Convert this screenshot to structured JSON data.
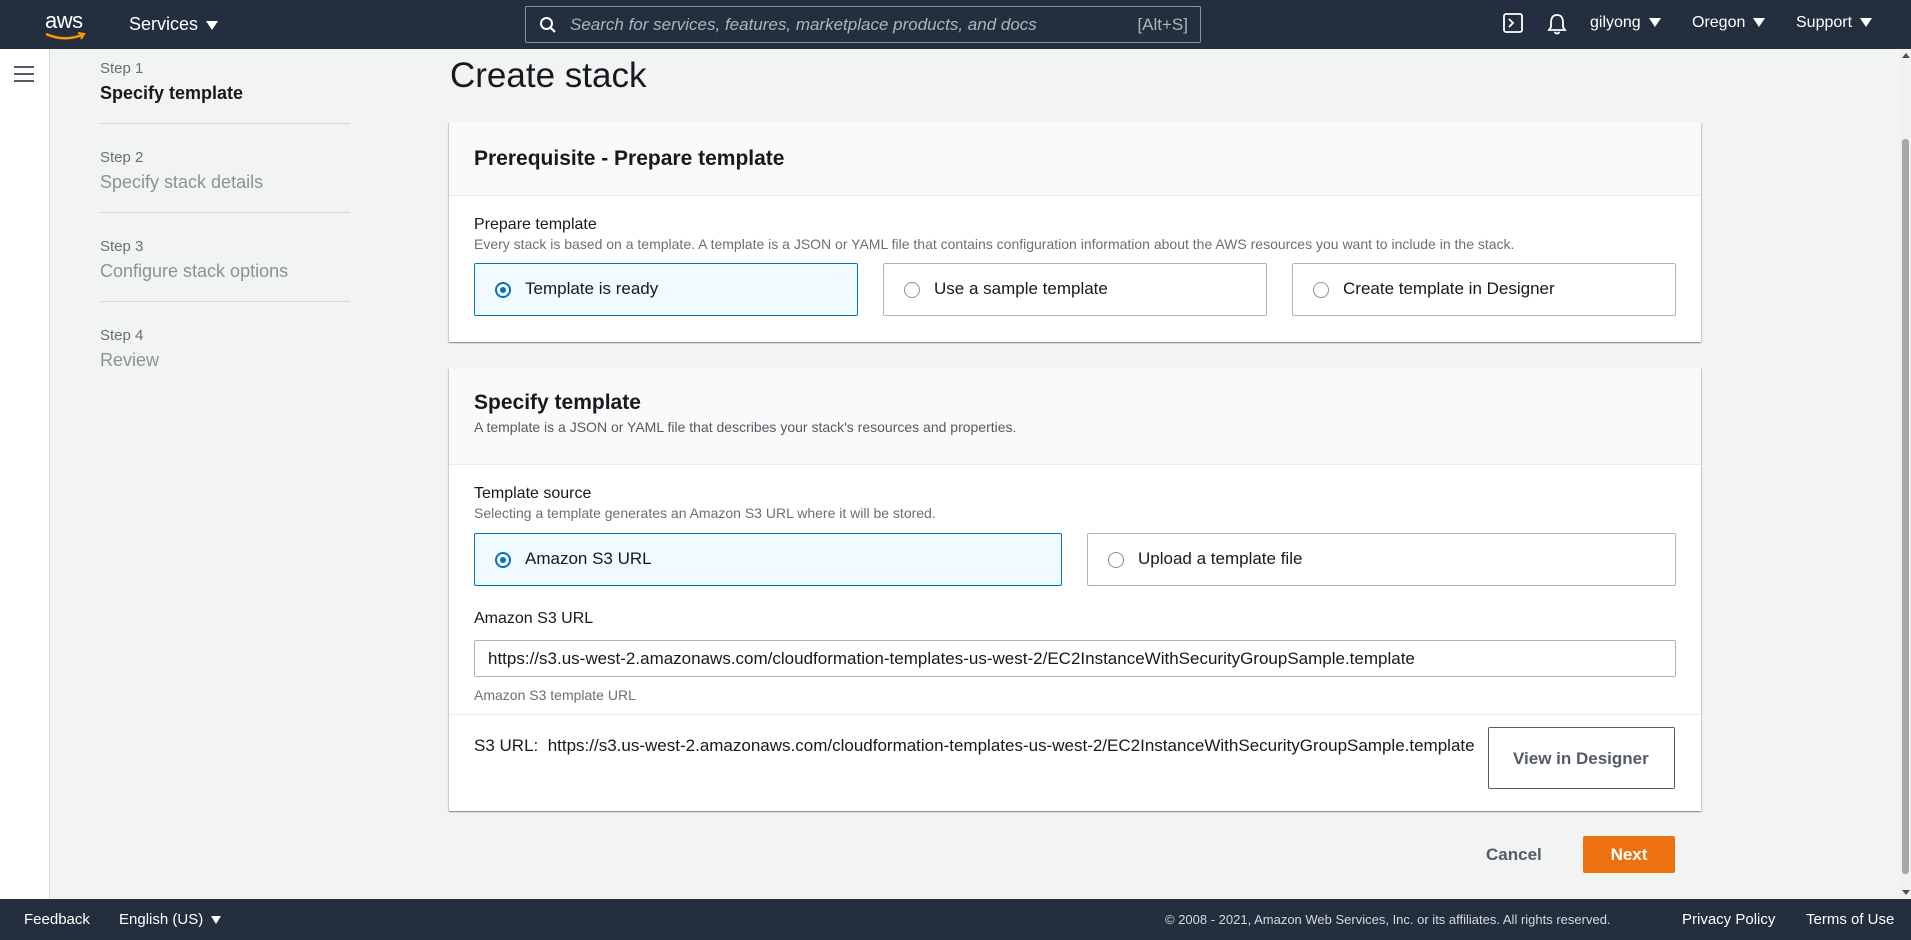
{
  "topnav": {
    "logo_text": "aws",
    "services_label": "Services",
    "search_placeholder": "Search for services, features, marketplace products, and docs",
    "search_shortcut": "[Alt+S]",
    "user_label": "gilyong",
    "region_label": "Oregon",
    "support_label": "Support",
    "icons": [
      "cloudshell-icon",
      "bell-icon"
    ]
  },
  "steps": [
    {
      "number": "Step 1",
      "title": "Specify template",
      "active": true
    },
    {
      "number": "Step 2",
      "title": "Specify stack details",
      "active": false
    },
    {
      "number": "Step 3",
      "title": "Configure stack options",
      "active": false
    },
    {
      "number": "Step 4",
      "title": "Review",
      "active": false
    }
  ],
  "page_title": "Create stack",
  "prerequisite": {
    "header": "Prerequisite - Prepare template",
    "field_label": "Prepare template",
    "field_desc": "Every stack is based on a template. A template is a JSON or YAML file that contains configuration information about the AWS resources you want to include in the stack.",
    "options": [
      {
        "label": "Template is ready",
        "selected": true
      },
      {
        "label": "Use a sample template",
        "selected": false
      },
      {
        "label": "Create template in Designer",
        "selected": false
      }
    ]
  },
  "specify": {
    "header": "Specify template",
    "header_desc": "A template is a JSON or YAML file that describes your stack's resources and properties.",
    "source_label": "Template source",
    "source_desc": "Selecting a template generates an Amazon S3 URL where it will be stored.",
    "source_options": [
      {
        "label": "Amazon S3 URL",
        "selected": true
      },
      {
        "label": "Upload a template file",
        "selected": false
      }
    ],
    "url_label": "Amazon S3 URL",
    "url_value": "https://s3.us-west-2.amazonaws.com/cloudformation-templates-us-west-2/EC2InstanceWithSecurityGroupSample.template",
    "url_hint": "Amazon S3 template URL",
    "s3_url_prefix": "S3 URL:",
    "s3_url_value": "https://s3.us-west-2.amazonaws.com/cloudformation-templates-us-west-2/EC2InstanceWithSecurityGroupSample.template",
    "designer_button": "View in Designer"
  },
  "actions": {
    "cancel": "Cancel",
    "next": "Next"
  },
  "footer": {
    "feedback": "Feedback",
    "language": "English (US)",
    "copyright": "© 2008 - 2021, Amazon Web Services, Inc. or its affiliates. All rights reserved.",
    "privacy": "Privacy Policy",
    "terms": "Terms of Use"
  },
  "colors": {
    "nav_bg": "#232f3e",
    "accent_blue": "#0073bb",
    "primary_orange": "#ec7211"
  }
}
